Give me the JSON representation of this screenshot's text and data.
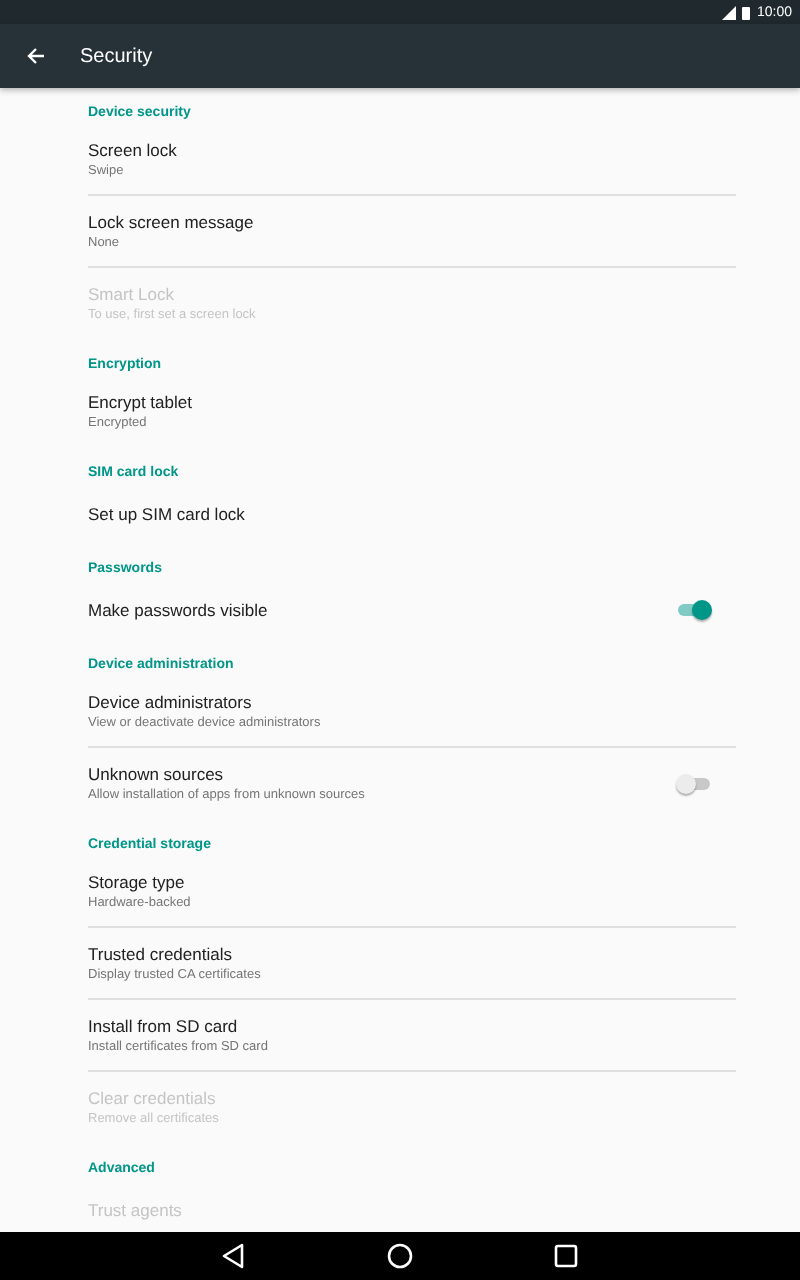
{
  "status_bar": {
    "time": "10:00"
  },
  "toolbar": {
    "title": "Security"
  },
  "sections": [
    {
      "header": "Device security",
      "items": [
        {
          "kind": "plain",
          "title": "Screen lock",
          "subtitle": "Swipe",
          "disabled": false
        },
        {
          "kind": "plain",
          "title": "Lock screen message",
          "subtitle": "None",
          "disabled": false
        },
        {
          "kind": "plain",
          "title": "Smart Lock",
          "subtitle": "To use, first set a screen lock",
          "disabled": true
        }
      ]
    },
    {
      "header": "Encryption",
      "items": [
        {
          "kind": "plain",
          "title": "Encrypt tablet",
          "subtitle": "Encrypted",
          "disabled": false
        }
      ]
    },
    {
      "header": "SIM card lock",
      "items": [
        {
          "kind": "plain",
          "title": "Set up SIM card lock",
          "disabled": false
        }
      ]
    },
    {
      "header": "Passwords",
      "items": [
        {
          "kind": "switch",
          "title": "Make passwords visible",
          "disabled": false,
          "on": true
        }
      ]
    },
    {
      "header": "Device administration",
      "items": [
        {
          "kind": "plain",
          "title": "Device administrators",
          "subtitle": "View or deactivate device administrators",
          "disabled": false
        },
        {
          "kind": "switch",
          "title": "Unknown sources",
          "subtitle": "Allow installation of apps from unknown sources",
          "disabled": false,
          "on": false
        }
      ]
    },
    {
      "header": "Credential storage",
      "items": [
        {
          "kind": "plain",
          "title": "Storage type",
          "subtitle": "Hardware-backed",
          "disabled": false
        },
        {
          "kind": "plain",
          "title": "Trusted credentials",
          "subtitle": "Display trusted CA certificates",
          "disabled": false
        },
        {
          "kind": "plain",
          "title": "Install from SD card",
          "subtitle": "Install certificates from SD card",
          "disabled": false
        },
        {
          "kind": "plain",
          "title": "Clear credentials",
          "subtitle": "Remove all certificates",
          "disabled": true
        }
      ]
    },
    {
      "header": "Advanced",
      "items": [
        {
          "kind": "plain",
          "title": "Trust agents",
          "disabled": true
        }
      ]
    }
  ]
}
